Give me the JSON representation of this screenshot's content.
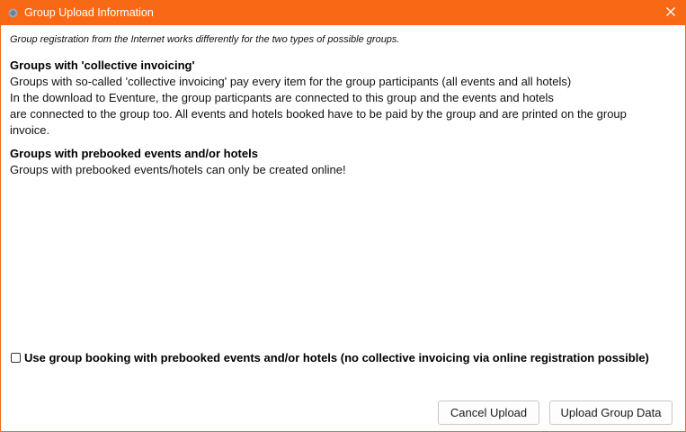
{
  "window": {
    "title": "Group Upload Information",
    "title_bar_color": "#f96915",
    "app_icon": "app-icon",
    "close_icon": "close-icon"
  },
  "content": {
    "intro": "Group registration from the Internet works differently for the two types of possible groups.",
    "section1": {
      "heading": "Groups with 'collective invoicing'",
      "lines": [
        "Groups with so-called 'collective invoicing' pay every item for the group participants (all events and all hotels)",
        "In the download to Eventure, the group particpants are connected to this group and the events and hotels",
        "are connected to the group too. All events and hotels booked have to be paid by the group and are printed on the group",
        "invoice."
      ]
    },
    "section2": {
      "heading": "Groups with prebooked events and/or hotels",
      "lines": [
        "Groups with prebooked events/hotels can only be created online!"
      ]
    }
  },
  "checkbox": {
    "label": "Use group booking with prebooked events and/or hotels (no collective invoicing via online registration possible)",
    "checked": false
  },
  "buttons": {
    "cancel": "Cancel Upload",
    "upload": "Upload Group Data"
  }
}
